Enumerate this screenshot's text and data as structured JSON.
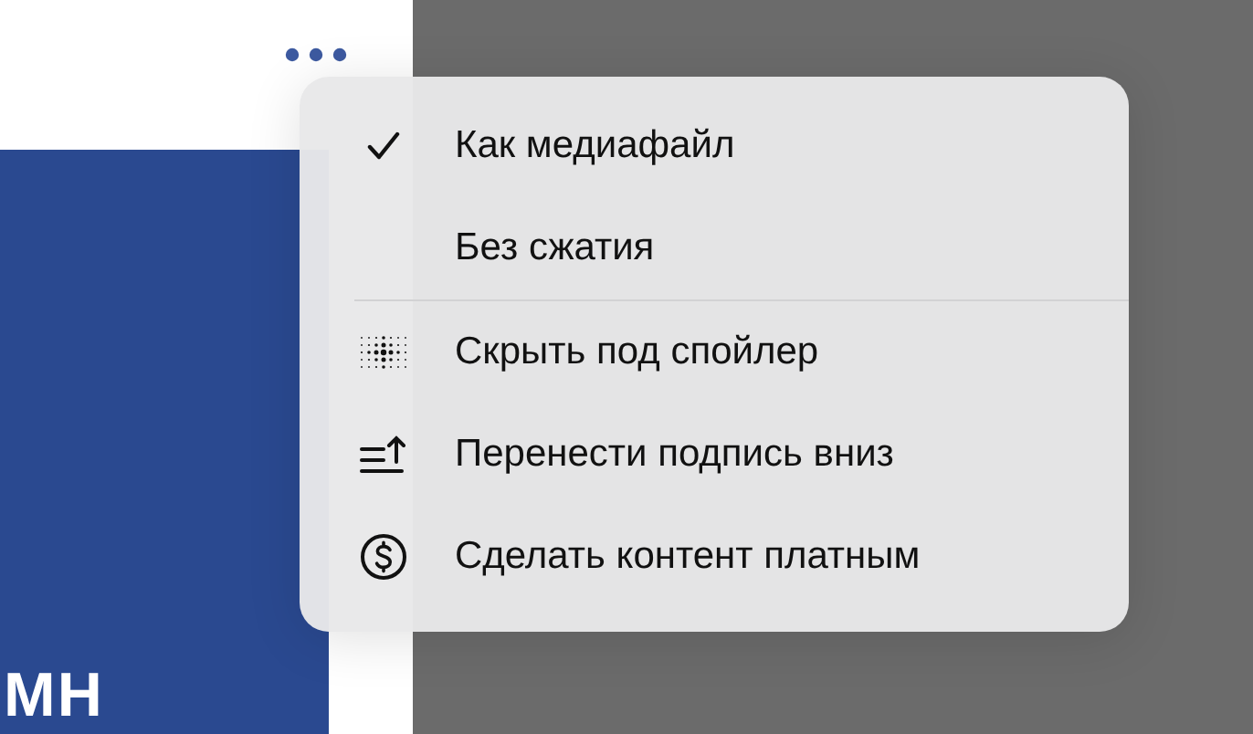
{
  "background": {
    "heading": "МН"
  },
  "menu": {
    "format_options": [
      {
        "label": "Как медиафайл",
        "selected": true
      },
      {
        "label": "Без сжатия",
        "selected": false
      }
    ],
    "actions": [
      {
        "label": "Скрыть под спойлер"
      },
      {
        "label": "Перенести подпись вниз"
      },
      {
        "label": "Сделать контент платным"
      }
    ]
  }
}
